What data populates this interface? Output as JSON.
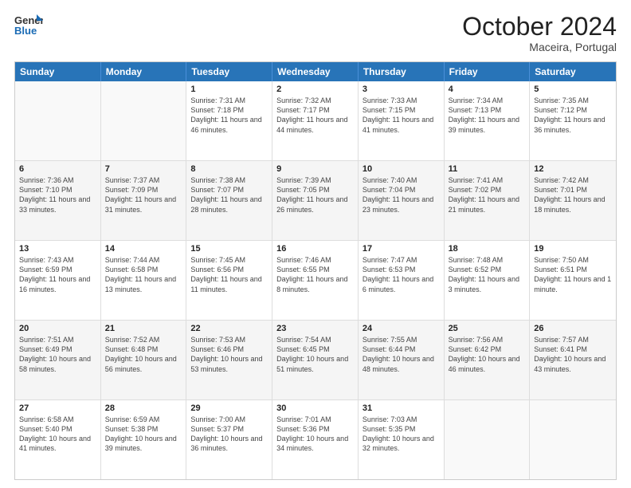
{
  "header": {
    "logo_line1": "General",
    "logo_line2": "Blue",
    "month": "October 2024",
    "location": "Maceira, Portugal"
  },
  "days_of_week": [
    "Sunday",
    "Monday",
    "Tuesday",
    "Wednesday",
    "Thursday",
    "Friday",
    "Saturday"
  ],
  "weeks": [
    [
      {
        "day": "",
        "sunrise": "",
        "sunset": "",
        "daylight": ""
      },
      {
        "day": "",
        "sunrise": "",
        "sunset": "",
        "daylight": ""
      },
      {
        "day": "1",
        "sunrise": "Sunrise: 7:31 AM",
        "sunset": "Sunset: 7:18 PM",
        "daylight": "Daylight: 11 hours and 46 minutes."
      },
      {
        "day": "2",
        "sunrise": "Sunrise: 7:32 AM",
        "sunset": "Sunset: 7:17 PM",
        "daylight": "Daylight: 11 hours and 44 minutes."
      },
      {
        "day": "3",
        "sunrise": "Sunrise: 7:33 AM",
        "sunset": "Sunset: 7:15 PM",
        "daylight": "Daylight: 11 hours and 41 minutes."
      },
      {
        "day": "4",
        "sunrise": "Sunrise: 7:34 AM",
        "sunset": "Sunset: 7:13 PM",
        "daylight": "Daylight: 11 hours and 39 minutes."
      },
      {
        "day": "5",
        "sunrise": "Sunrise: 7:35 AM",
        "sunset": "Sunset: 7:12 PM",
        "daylight": "Daylight: 11 hours and 36 minutes."
      }
    ],
    [
      {
        "day": "6",
        "sunrise": "Sunrise: 7:36 AM",
        "sunset": "Sunset: 7:10 PM",
        "daylight": "Daylight: 11 hours and 33 minutes."
      },
      {
        "day": "7",
        "sunrise": "Sunrise: 7:37 AM",
        "sunset": "Sunset: 7:09 PM",
        "daylight": "Daylight: 11 hours and 31 minutes."
      },
      {
        "day": "8",
        "sunrise": "Sunrise: 7:38 AM",
        "sunset": "Sunset: 7:07 PM",
        "daylight": "Daylight: 11 hours and 28 minutes."
      },
      {
        "day": "9",
        "sunrise": "Sunrise: 7:39 AM",
        "sunset": "Sunset: 7:05 PM",
        "daylight": "Daylight: 11 hours and 26 minutes."
      },
      {
        "day": "10",
        "sunrise": "Sunrise: 7:40 AM",
        "sunset": "Sunset: 7:04 PM",
        "daylight": "Daylight: 11 hours and 23 minutes."
      },
      {
        "day": "11",
        "sunrise": "Sunrise: 7:41 AM",
        "sunset": "Sunset: 7:02 PM",
        "daylight": "Daylight: 11 hours and 21 minutes."
      },
      {
        "day": "12",
        "sunrise": "Sunrise: 7:42 AM",
        "sunset": "Sunset: 7:01 PM",
        "daylight": "Daylight: 11 hours and 18 minutes."
      }
    ],
    [
      {
        "day": "13",
        "sunrise": "Sunrise: 7:43 AM",
        "sunset": "Sunset: 6:59 PM",
        "daylight": "Daylight: 11 hours and 16 minutes."
      },
      {
        "day": "14",
        "sunrise": "Sunrise: 7:44 AM",
        "sunset": "Sunset: 6:58 PM",
        "daylight": "Daylight: 11 hours and 13 minutes."
      },
      {
        "day": "15",
        "sunrise": "Sunrise: 7:45 AM",
        "sunset": "Sunset: 6:56 PM",
        "daylight": "Daylight: 11 hours and 11 minutes."
      },
      {
        "day": "16",
        "sunrise": "Sunrise: 7:46 AM",
        "sunset": "Sunset: 6:55 PM",
        "daylight": "Daylight: 11 hours and 8 minutes."
      },
      {
        "day": "17",
        "sunrise": "Sunrise: 7:47 AM",
        "sunset": "Sunset: 6:53 PM",
        "daylight": "Daylight: 11 hours and 6 minutes."
      },
      {
        "day": "18",
        "sunrise": "Sunrise: 7:48 AM",
        "sunset": "Sunset: 6:52 PM",
        "daylight": "Daylight: 11 hours and 3 minutes."
      },
      {
        "day": "19",
        "sunrise": "Sunrise: 7:50 AM",
        "sunset": "Sunset: 6:51 PM",
        "daylight": "Daylight: 11 hours and 1 minute."
      }
    ],
    [
      {
        "day": "20",
        "sunrise": "Sunrise: 7:51 AM",
        "sunset": "Sunset: 6:49 PM",
        "daylight": "Daylight: 10 hours and 58 minutes."
      },
      {
        "day": "21",
        "sunrise": "Sunrise: 7:52 AM",
        "sunset": "Sunset: 6:48 PM",
        "daylight": "Daylight: 10 hours and 56 minutes."
      },
      {
        "day": "22",
        "sunrise": "Sunrise: 7:53 AM",
        "sunset": "Sunset: 6:46 PM",
        "daylight": "Daylight: 10 hours and 53 minutes."
      },
      {
        "day": "23",
        "sunrise": "Sunrise: 7:54 AM",
        "sunset": "Sunset: 6:45 PM",
        "daylight": "Daylight: 10 hours and 51 minutes."
      },
      {
        "day": "24",
        "sunrise": "Sunrise: 7:55 AM",
        "sunset": "Sunset: 6:44 PM",
        "daylight": "Daylight: 10 hours and 48 minutes."
      },
      {
        "day": "25",
        "sunrise": "Sunrise: 7:56 AM",
        "sunset": "Sunset: 6:42 PM",
        "daylight": "Daylight: 10 hours and 46 minutes."
      },
      {
        "day": "26",
        "sunrise": "Sunrise: 7:57 AM",
        "sunset": "Sunset: 6:41 PM",
        "daylight": "Daylight: 10 hours and 43 minutes."
      }
    ],
    [
      {
        "day": "27",
        "sunrise": "Sunrise: 6:58 AM",
        "sunset": "Sunset: 5:40 PM",
        "daylight": "Daylight: 10 hours and 41 minutes."
      },
      {
        "day": "28",
        "sunrise": "Sunrise: 6:59 AM",
        "sunset": "Sunset: 5:38 PM",
        "daylight": "Daylight: 10 hours and 39 minutes."
      },
      {
        "day": "29",
        "sunrise": "Sunrise: 7:00 AM",
        "sunset": "Sunset: 5:37 PM",
        "daylight": "Daylight: 10 hours and 36 minutes."
      },
      {
        "day": "30",
        "sunrise": "Sunrise: 7:01 AM",
        "sunset": "Sunset: 5:36 PM",
        "daylight": "Daylight: 10 hours and 34 minutes."
      },
      {
        "day": "31",
        "sunrise": "Sunrise: 7:03 AM",
        "sunset": "Sunset: 5:35 PM",
        "daylight": "Daylight: 10 hours and 32 minutes."
      },
      {
        "day": "",
        "sunrise": "",
        "sunset": "",
        "daylight": ""
      },
      {
        "day": "",
        "sunrise": "",
        "sunset": "",
        "daylight": ""
      }
    ]
  ]
}
